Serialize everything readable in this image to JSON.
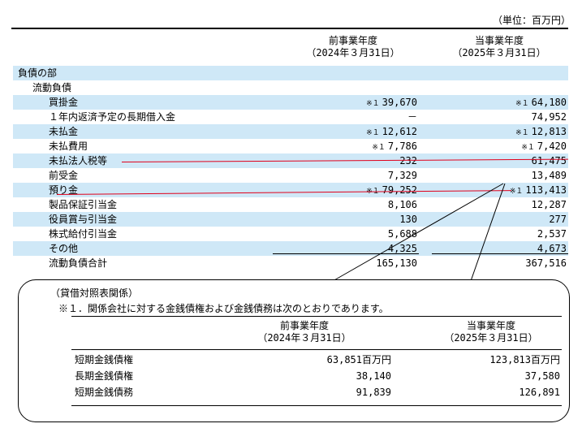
{
  "unit": "（単位：百万円）",
  "columns": {
    "prev": {
      "label": "前事業年度",
      "date": "（2024年３月31日）"
    },
    "curr": {
      "label": "当事業年度",
      "date": "（2025年３月31日）"
    }
  },
  "rows": [
    {
      "label": "負債の部",
      "prev": "",
      "curr": "",
      "indent": 0
    },
    {
      "label": "流動負債",
      "prev": "",
      "curr": "",
      "indent": 1
    },
    {
      "label": "買掛金",
      "prev_note": "※１",
      "prev": "39,670",
      "curr_note": "※１",
      "curr": "64,180",
      "indent": 2
    },
    {
      "label": "１年内返済予定の長期借入金",
      "prev": "－",
      "curr": "74,952",
      "indent": 2
    },
    {
      "label": "未払金",
      "prev_note": "※１",
      "prev": "12,612",
      "curr_note": "※１",
      "curr": "12,813",
      "indent": 2
    },
    {
      "label": "未払費用",
      "prev_note": "※１",
      "prev": "7,786",
      "curr_note": "※１",
      "curr": "7,420",
      "indent": 2
    },
    {
      "label": "未払法人税等",
      "prev": "232",
      "curr": "61,475",
      "indent": 2
    },
    {
      "label": "前受金",
      "prev": "7,329",
      "curr": "13,489",
      "indent": 2
    },
    {
      "label": "預り金",
      "prev_note": "※１",
      "prev": "79,252",
      "curr_note": "※１",
      "curr": "113,413",
      "indent": 2
    },
    {
      "label": "製品保証引当金",
      "prev": "8,106",
      "curr": "12,287",
      "indent": 2
    },
    {
      "label": "役員賞与引当金",
      "prev": "130",
      "curr": "277",
      "indent": 2
    },
    {
      "label": "株式給付引当金",
      "prev": "5,688",
      "curr": "2,537",
      "indent": 2
    },
    {
      "label": "その他",
      "prev": "4,325",
      "curr": "4,673",
      "indent": 2
    },
    {
      "label": "流動負債合計",
      "prev": "165,130",
      "curr": "367,516",
      "indent": 2
    }
  ],
  "callout": {
    "title": "（貸借対照表関係）",
    "note": "※１．関係会社に対する金銭債権および金銭債務は次のとおりであります。",
    "prev": {
      "label": "前事業年度",
      "date": "（2024年３月31日）"
    },
    "curr": {
      "label": "当事業年度",
      "date": "（2025年３月31日）"
    },
    "rows": [
      {
        "label": "短期金銭債権",
        "prev": "63,851百万円",
        "curr": "123,813百万円"
      },
      {
        "label": "長期金銭債権",
        "prev": "38,140",
        "curr": "37,580"
      },
      {
        "label": "短期金銭債務",
        "prev": "91,839",
        "curr": "126,891"
      }
    ]
  }
}
